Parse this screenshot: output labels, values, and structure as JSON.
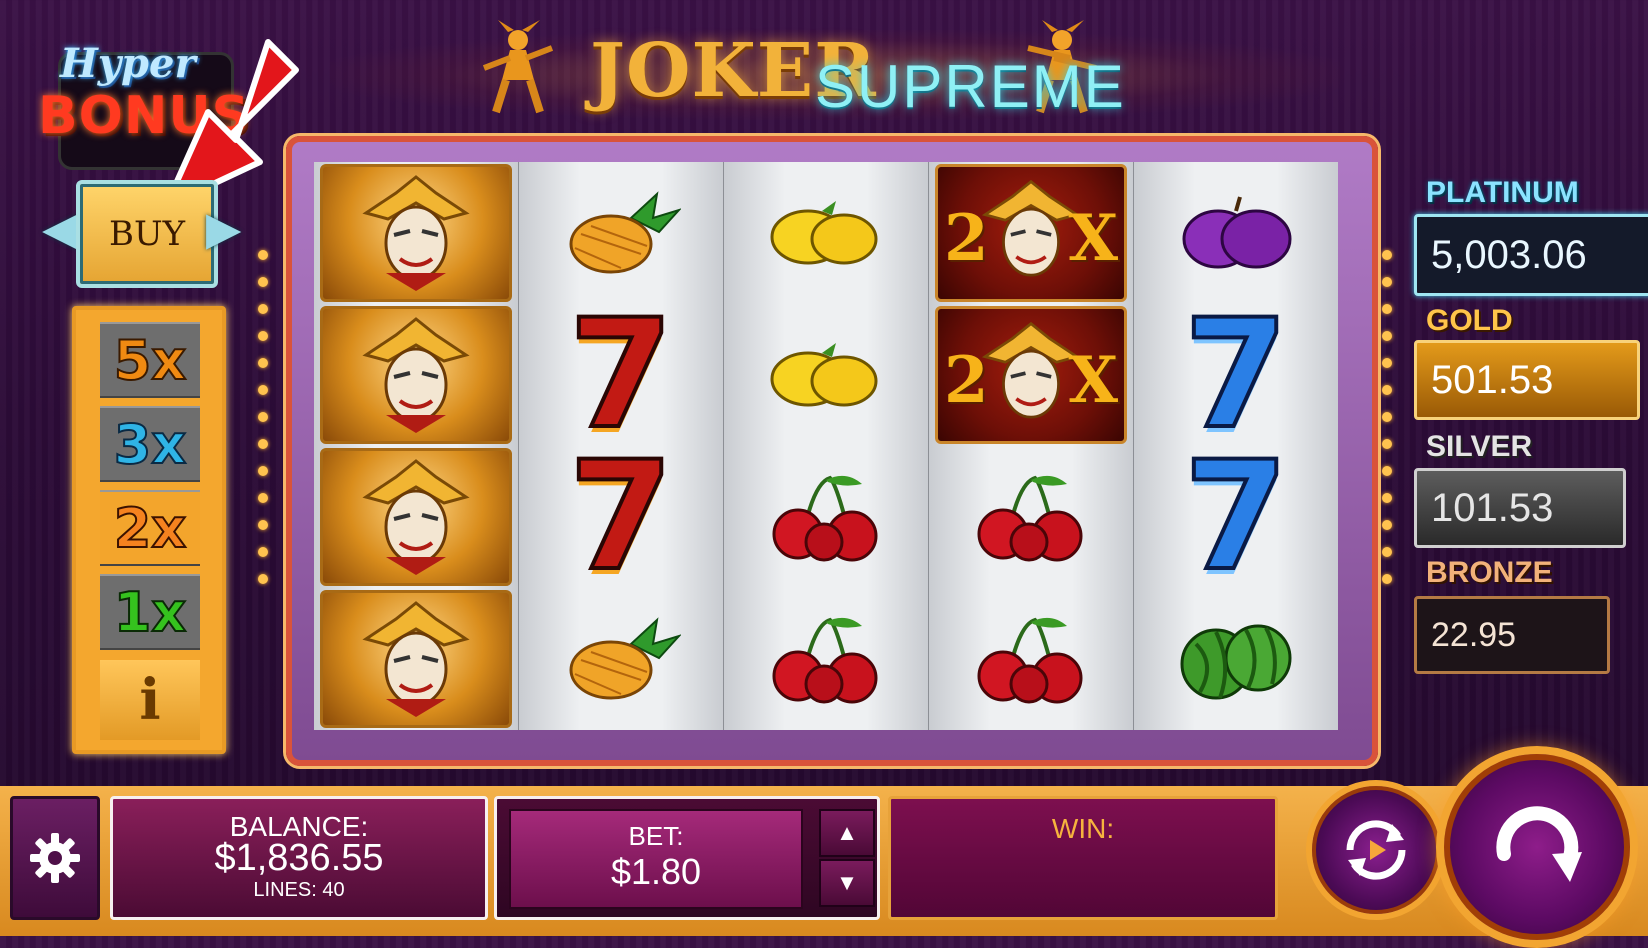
{
  "title": {
    "main": "JOKER",
    "sub": "SUPREME"
  },
  "hyper_bonus": {
    "line1": "Hyper",
    "line2": "BONUS"
  },
  "buy": {
    "label": "BUY"
  },
  "multipliers": [
    {
      "label": "5x",
      "color": "#f08a12"
    },
    {
      "label": "3x",
      "color": "#2fb4e6"
    },
    {
      "label": "2x",
      "color": "#f5821f"
    },
    {
      "label": "1x",
      "color": "#35c21e"
    }
  ],
  "info": {
    "label": "i"
  },
  "reels": [
    [
      "joker",
      "joker",
      "joker",
      "joker"
    ],
    [
      "pineapple",
      "seven-red",
      "seven-red",
      "pineapple"
    ],
    [
      "lemon",
      "lemon",
      "cherry",
      "cherry"
    ],
    [
      "joker-2x",
      "joker-2x",
      "cherry",
      "cherry"
    ],
    [
      "plum",
      "seven-blue",
      "seven-blue",
      "watermelon"
    ]
  ],
  "joker_multiplier_label": "2X",
  "jackpots": {
    "platinum": {
      "label": "PLATINUM",
      "value": "5,003.06"
    },
    "gold": {
      "label": "GOLD",
      "value": "501.53"
    },
    "silver": {
      "label": "SILVER",
      "value": "101.53"
    },
    "bronze": {
      "label": "BRONZE",
      "value": "22.95"
    }
  },
  "balance": {
    "label": "BALANCE:",
    "value": "$1,836.55",
    "lines": "LINES: 40"
  },
  "bet": {
    "label": "BET:",
    "value": "$1.80",
    "up": "▲",
    "down": "▼"
  },
  "win": {
    "label": "WIN:",
    "value": ""
  },
  "icons": {
    "settings": "gear-icon",
    "autoplay": "autoplay-icon",
    "spin": "spin-icon",
    "arrow": "red-arrow-icon"
  }
}
